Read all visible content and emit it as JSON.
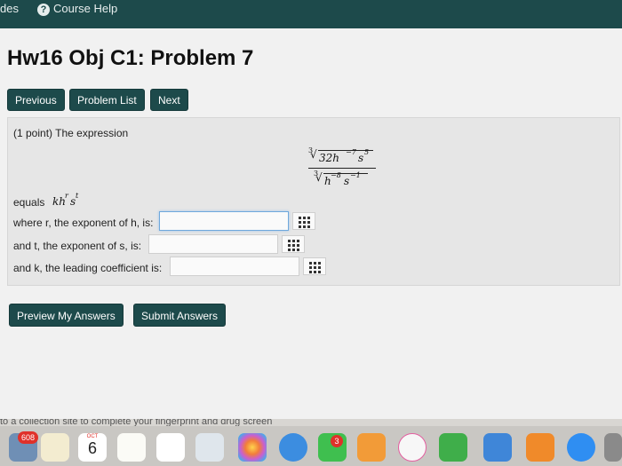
{
  "topbar": {
    "left_fragment": "des",
    "help": "Course Help"
  },
  "title": "Hw16 Obj C1: Problem 7",
  "nav": {
    "previous": "Previous",
    "list": "Problem List",
    "next": "Next"
  },
  "problem": {
    "intro": "(1 point) The expression",
    "numerator_index": "3",
    "numerator": "32h",
    "num_exp_h": "−7",
    "num_s": "s",
    "num_exp_s": "5",
    "denominator_index": "3",
    "denominator": "h",
    "den_exp_h": "−8",
    "den_s": "s",
    "den_exp_s": "−1",
    "equals_prefix": "equals",
    "form": "kh",
    "form_exp_r": "r",
    "form_s": "s",
    "form_exp_t": "t",
    "q1": "where r, the exponent of h, is:",
    "q2": "and t, the exponent of s, is:",
    "q3": "and k, the leading coefficient is:"
  },
  "actions": {
    "preview": "Preview My Answers",
    "submit": "Submit Answers"
  },
  "dock": {
    "strip_text": "to a collection site to complete your fingerprint and drug screen",
    "mail_badge": "608",
    "calendar_month": "OCT",
    "calendar_day": "6",
    "badge_3": "3",
    "colors": {
      "accent": "#1d4a4b",
      "badge": "#e0312a"
    }
  }
}
